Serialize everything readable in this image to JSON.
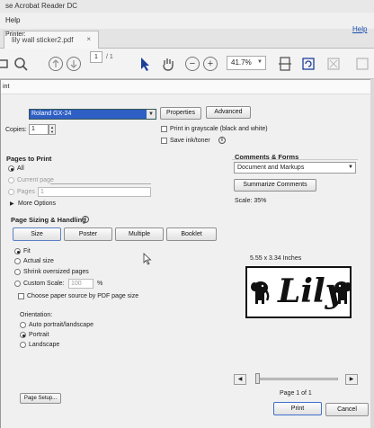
{
  "app": {
    "title": "se Acrobat Reader DC",
    "menu": [
      "Help"
    ],
    "tab_label": "lily wall sticker2.pdf",
    "tab_close": "×",
    "page_current": "1",
    "page_total": "/ 1",
    "zoom": "41.7%"
  },
  "dialog": {
    "title": "int",
    "help": "Help",
    "printer_label": "Printer:",
    "printer_value": "Roland GX-24",
    "properties": "Properties",
    "advanced": "Advanced",
    "copies_label": "Copies:",
    "copies_value": "1",
    "grayscale_label": "Print in grayscale (black and white)",
    "save_ink_label": "Save ink/toner",
    "pages_to_print": {
      "heading": "Pages to Print",
      "all": "All",
      "current_page": "Current page",
      "pages": "Pages",
      "pages_value": "1",
      "more_options": "More Options"
    },
    "sizing": {
      "heading": "Page Sizing & Handling",
      "tabs": [
        "Size",
        "Poster",
        "Multiple",
        "Booklet"
      ],
      "fit": "Fit",
      "actual_size": "Actual size",
      "shrink": "Shrink oversized pages",
      "custom_scale": "Custom Scale:",
      "custom_value": "100",
      "percent": "%",
      "choose_source": "Choose paper source by PDF page size"
    },
    "orientation": {
      "heading": "Orientation:",
      "auto": "Auto portrait/landscape",
      "portrait": "Portrait",
      "landscape": "Landscape"
    },
    "comments": {
      "heading": "Comments & Forms",
      "select_value": "Document and Markups",
      "summarize": "Summarize Comments",
      "scale": "Scale: 35%"
    },
    "preview": {
      "dimensions": "5.55 x 3.34 Inches",
      "sticker_text": "Lily",
      "page_indicator": "Page 1 of 1"
    },
    "page_setup": "Page Setup...",
    "print": "Print",
    "cancel": "Cancel"
  }
}
